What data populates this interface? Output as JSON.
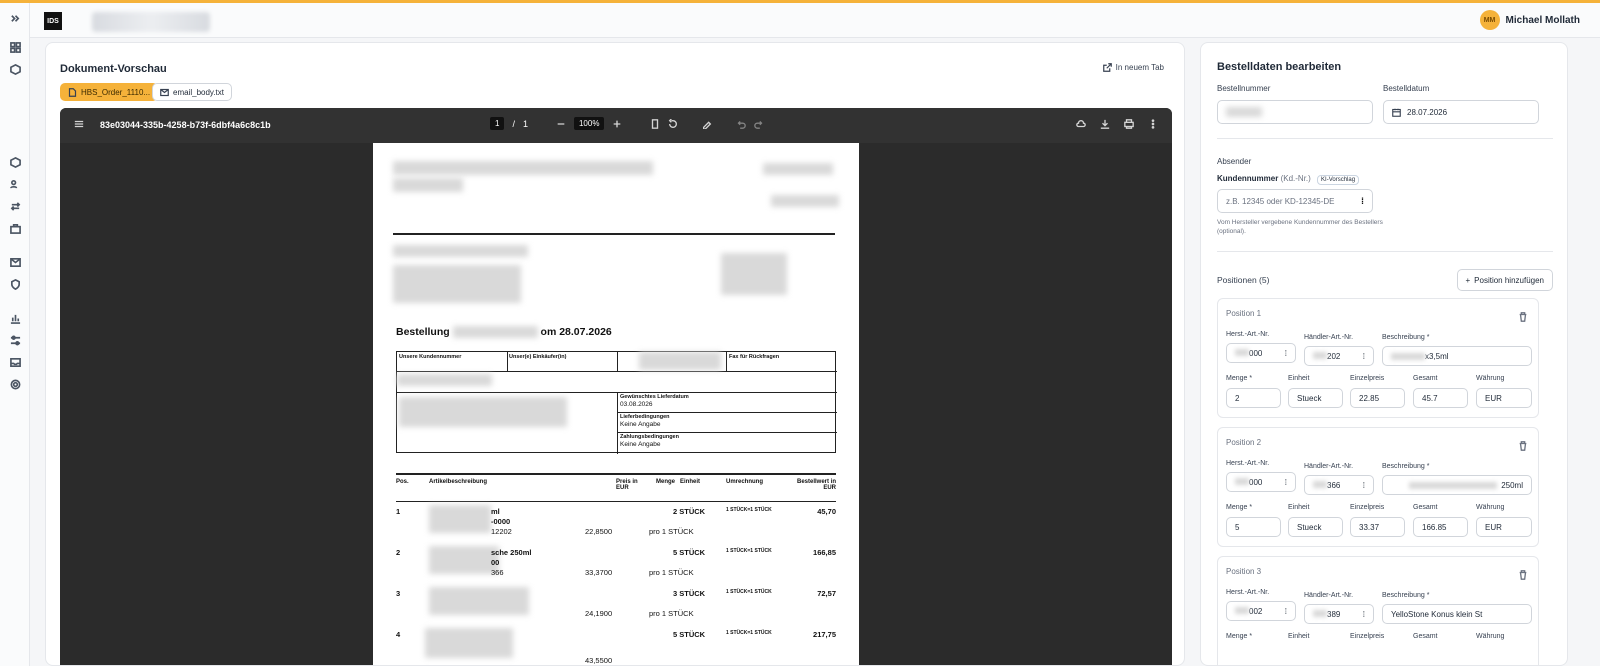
{
  "user": {
    "initials": "MM",
    "name": "Michael Mollath"
  },
  "logo": "IDS",
  "preview": {
    "title": "Dokument-Vorschau",
    "new_tab": "In neuem Tab",
    "files": [
      "HBS_Order_1110...",
      "email_body.txt"
    ],
    "viewer": {
      "doc_id": "83e03044-335b-4258-b73f-6dbf4a6c8c1b",
      "page": "1",
      "total": "1",
      "zoom": "100%"
    },
    "document": {
      "heading_prefix": "Bestellung",
      "heading_suffix": "om  28.07.2026",
      "box_labels": [
        "Unsere Kundennummer",
        "Unser(e) Einkäufer(in)",
        "Fax für Rückfragen"
      ],
      "delivery_date_label": "Gewünschtes Lieferdatum",
      "delivery_date": "03.08.2026",
      "terms_label": "Lieferbedingungen",
      "terms": "Keine Angabe",
      "payment_label": "Zahlungsbedingungen",
      "payment": "Keine Angabe",
      "columns": [
        "Pos.",
        "Artikelbeschreibung",
        "Preis in EUR",
        "Menge",
        "Einheit",
        "Umrechnung",
        "Bestellwert in EUR"
      ],
      "rows": [
        {
          "pos": "1",
          "desc": "ml",
          "desc2": "-0000",
          "desc3": "12202",
          "price": "22,8500",
          "qty": "2 STÜCK",
          "conv": "1 STÜCK=1 STÜCK",
          "total": "45,70",
          "per": "pro 1 STÜCK"
        },
        {
          "pos": "2",
          "desc": "sche 250ml",
          "desc2": "00",
          "desc3": "366",
          "price": "33,3700",
          "qty": "5 STÜCK",
          "conv": "1 STÜCK=1 STÜCK",
          "total": "166,85",
          "per": "pro 1 STÜCK"
        },
        {
          "pos": "3",
          "desc": "",
          "desc2": "",
          "desc3": "",
          "price": "24,1900",
          "qty": "3 STÜCK",
          "conv": "1 STÜCK=1 STÜCK",
          "total": "72,57",
          "per": "pro 1 STÜCK"
        },
        {
          "pos": "4",
          "desc": "",
          "desc2": "",
          "desc3": "",
          "price": "43,5500",
          "qty": "5 STÜCK",
          "conv": "1 STÜCK=1 STÜCK",
          "total": "217,75",
          "per": ""
        }
      ]
    }
  },
  "form": {
    "title": "Bestelldaten bearbeiten",
    "order_number_label": "Bestellnummer",
    "order_date_label": "Bestelldatum",
    "order_date": "28.07.2026",
    "sender_label": "Absender",
    "customer_label": "Kundennummer",
    "customer_suffix": "(Kd.-Nr.)",
    "ai_badge": "KI-Vorschlag",
    "customer_placeholder": "z.B. 12345 oder KD-12345-DE",
    "customer_hint": "Vom Hersteller vergebene Kundennummer des Bestellers (optional).",
    "positions_label": "Positionen (5)",
    "add_position": "Position hinzufügen",
    "field_labels": {
      "mfr": "Herst.-Art.-Nr.",
      "dealer": "Händler-Art.-Nr.",
      "desc": "Beschreibung *",
      "qty": "Menge *",
      "unit": "Einheit",
      "price": "Einzelpreis",
      "total": "Gesamt",
      "currency": "Währung"
    },
    "positions": [
      {
        "title": "Position 1",
        "mfr": "000",
        "dealer": "202",
        "desc": "x3,5ml",
        "qty": "2",
        "unit": "Stueck",
        "price": "22.85",
        "total": "45.7",
        "currency": "EUR"
      },
      {
        "title": "Position 2",
        "mfr": "000",
        "dealer": "366",
        "desc": "250ml",
        "qty": "5",
        "unit": "Stueck",
        "price": "33.37",
        "total": "166.85",
        "currency": "EUR"
      },
      {
        "title": "Position 3",
        "mfr": "002",
        "dealer": "389",
        "desc": "YelloStone Konus klein St",
        "qty": "",
        "unit": "",
        "price": "",
        "total": "",
        "currency": ""
      }
    ]
  }
}
